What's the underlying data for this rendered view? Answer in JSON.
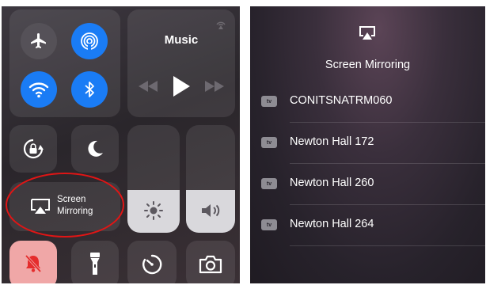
{
  "control_center": {
    "music": {
      "title": "Music"
    },
    "screen_mirroring": {
      "line1": "Screen",
      "line2": "Mirroring"
    }
  },
  "screen_mirroring_menu": {
    "title": "Screen Mirroring",
    "devices": [
      {
        "badge": "tv",
        "name": "CONITSNATRM060"
      },
      {
        "badge": "tv",
        "name": "Newton Hall 172"
      },
      {
        "badge": "tv",
        "name": "Newton Hall 260"
      },
      {
        "badge": "tv",
        "name": "Newton Hall 264"
      }
    ]
  },
  "icons": {
    "airplane": "airplane-icon",
    "airdrop": "airdrop-icon",
    "wifi": "wifi-icon",
    "bluetooth": "bluetooth-icon",
    "airplay_small": "airplay-audio-icon",
    "rewind": "rewind-icon",
    "play": "play-icon",
    "fast_forward": "fast-forward-icon",
    "rotation_lock": "rotation-lock-icon",
    "do_not_disturb": "moon-icon",
    "brightness": "sun-icon",
    "volume": "speaker-icon",
    "screen_mirroring": "screen-mirroring-icon",
    "silent": "bell-slash-icon",
    "flashlight": "flashlight-icon",
    "timer": "timer-icon",
    "camera": "camera-icon"
  },
  "colors": {
    "blue_active": "#1a7cf5",
    "silent_active": "#f0a7a7",
    "annotation_red": "#e01515",
    "slider_fill": "#d9d8dc"
  },
  "levels": {
    "brightness": 0.4,
    "volume": 0.4
  }
}
